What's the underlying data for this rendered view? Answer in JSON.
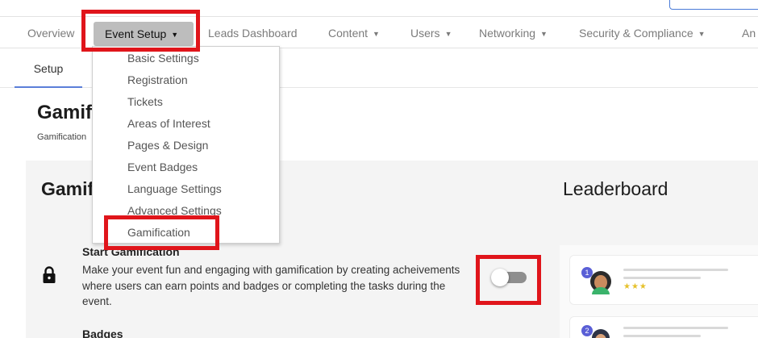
{
  "nav": {
    "items": [
      {
        "label": "Overview",
        "has_caret": false
      },
      {
        "label": "Event Setup",
        "has_caret": true,
        "active": true
      },
      {
        "label": "Leads Dashboard",
        "has_caret": false
      },
      {
        "label": "Content",
        "has_caret": true
      },
      {
        "label": "Users",
        "has_caret": true
      },
      {
        "label": "Networking",
        "has_caret": true
      },
      {
        "label": "Security & Compliance",
        "has_caret": true
      },
      {
        "label": "An",
        "has_caret": false
      }
    ]
  },
  "subnav": {
    "tab": "Setup"
  },
  "page": {
    "title": "Gamification",
    "breadcrumb": "Gamification"
  },
  "panel": {
    "title": "Gamification",
    "leaderboard_title": "Leaderboard",
    "start": {
      "title": "Start Gamification",
      "description": "Make your event fun and engaging with gamification by creating acheivements where users can earn points and badges or completing the tasks during the event."
    },
    "toggle_on": false,
    "badges_label": "Badges"
  },
  "dropdown": {
    "items": [
      "Basic Settings",
      "Registration",
      "Tickets",
      "Areas of Interest",
      "Pages & Design",
      "Event Badges",
      "Language Settings",
      "Advanced Settings",
      "Gamification"
    ]
  },
  "leaderboard_preview": {
    "ranks": [
      "1",
      "2"
    ],
    "stars": "★★★"
  },
  "icons": {
    "caret": "▼",
    "lock": "lock-icon"
  },
  "colors": {
    "highlight": "#e0151b",
    "active_nav": "#bdbdbd",
    "accent": "#5b7fd9",
    "rank_badge": "#5a5fd6",
    "star": "#e6c12b"
  }
}
